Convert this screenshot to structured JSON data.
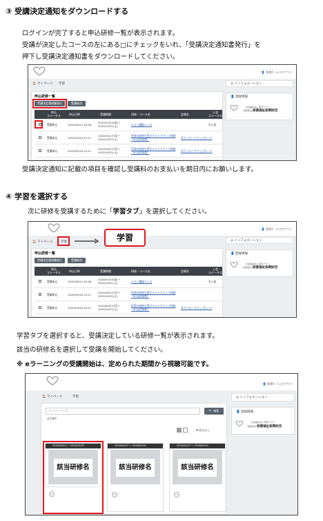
{
  "section3": {
    "heading": "③ 受講決定通知をダウンロードする",
    "line1": "ログインが完了すると申込研修一覧が表示されます。",
    "line2": "受講が決定したコースの左にある□にチェックをいれ、「受講決定通知書発行」を",
    "line3": "押下し受講決定通知書をダウンロードしてください。",
    "after": "受講決定通知に記載の項目を確認し受講料のお支払いを期日内にお願いします。"
  },
  "section4": {
    "heading": "④ 学習を選択する",
    "intro_pre": "次に研修を受講するために「",
    "intro_bold": "学習タブ",
    "intro_post": "」を選択してください。",
    "callout": "学習",
    "after1": "学習タブを選択すると、受講決定している研修一覧が表示されます。",
    "after2": "該当の研修名を選択して受講を開始してください。",
    "note": "※ eラーニングの受講開始は、定められた期間から視聴可能です。"
  },
  "app": {
    "header_user": "👤 保育A",
    "header_logout": "⇥ ログアウト",
    "tab_mypage": "🏠 マイページ",
    "tab_learning": "学習",
    "info_label": "◎ インフォメーション",
    "register_label": "👤 登録情報",
    "org_line1": "一般財団法人",
    "org_line2": "保健福祉振興財団",
    "org_small": "社会福祉法人 保育プラス",
    "list_title": "申込研修一覧",
    "btn_issue": "受講決定通知書発行",
    "btn_cancel": "受講取消",
    "columns": [
      "",
      "申込\nステータス",
      "申込日時",
      "受講期間",
      "研修・コース名",
      "会場名",
      "入金\nステータス"
    ],
    "rows": [
      {
        "status": "受講申込",
        "date": "2020/09/14 16:38",
        "period": "2020/07/03(金)〜2020/10/31(土)",
        "course": "テスト講座エリス",
        "dl": "",
        "pay": "不入金"
      },
      {
        "status": "受講申込",
        "date": "2020/09/16 10:21",
        "period": "2020/04/27(月)〜2020/10/31(土)",
        "course": "世保の研修を受けキャリアアップ研修（B 乳児保育）",
        "dl": "ダウンロードアップロード",
        "pay": ""
      },
      {
        "status": "受講申込",
        "date": "2020/09/16 10:21",
        "period": "2020/04/27(月)〜2020/10/31(土)",
        "course": "世保の研修を受けキャリアアップ研修（B 乳児保育）",
        "dl": "ダウンロードアップロード",
        "pay": ""
      }
    ],
    "search_placeholder": "キーワード入力",
    "search_button": "🔍 検索",
    "sub_label": "全件選択",
    "sort_label": "並び順",
    "filter_label": "▼ 絞込なし",
    "cards": [
      {
        "period": "2020/09/14 〜 2020/10/31",
        "name": "該当研修名",
        "pct": "0%"
      },
      {
        "period": "2020/04/27 〜 2026/03/31",
        "name": "該当研修名",
        "pct": "0%"
      },
      {
        "period": "2020/04/27 〜 2026/03/31",
        "name": "該当研修名",
        "pct": "0%"
      }
    ]
  },
  "colors": {
    "red": "#e0141b",
    "dark": "#3c4147"
  }
}
